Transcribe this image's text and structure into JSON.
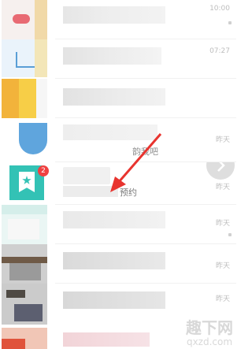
{
  "chat_list": {
    "items": [
      {
        "time": "10:00"
      },
      {
        "time": "07:27"
      },
      {
        "time": ""
      },
      {
        "time": "昨天",
        "preview_fragment": "韵我吧"
      },
      {
        "time": "昨天",
        "badge_count": "2",
        "preview_fragment": "预约"
      },
      {
        "time": "昨天"
      },
      {
        "time": "昨天"
      },
      {
        "time": "昨天"
      }
    ]
  },
  "watermark": {
    "title": "趣下网",
    "url": "qxzd.com"
  },
  "colors": {
    "accent_teal": "#33c2b5",
    "badge_red": "#f04141",
    "arrow_red": "#e8342f",
    "timestamp_gray": "#bdbdbd"
  }
}
